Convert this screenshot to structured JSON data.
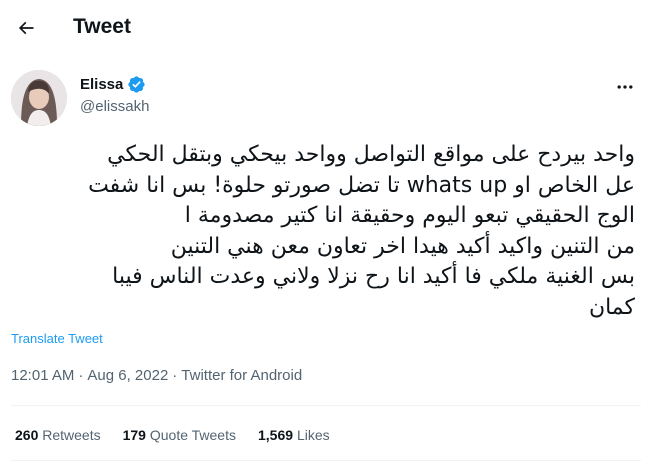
{
  "header": {
    "title": "Tweet",
    "back_icon": "arrow-left-icon"
  },
  "author": {
    "display_name": "Elissa",
    "handle": "@elissakh",
    "verified_color": "#1d9bf0"
  },
  "tweet": {
    "lines": [
      "واحد بيردح  على مواقع التواصل وواحد بيحكي  وبتقل الحكي",
      "عل الخاص او whats up تا تضل صورتو حلوة! بس انا شفت",
      "الوج الحقيقي تبعو اليوم وحقيقة انا كتير  مصدومة ا",
      "من التنين واكيد أكيد هيدا اخر تعاون معن هني التنين",
      "بس الغنية ملكي فا أكيد انا رح نزلا ولاني وعدت الناس فيبا",
      "كمان"
    ],
    "translate_label": "Translate Tweet"
  },
  "meta": {
    "time": "12:01 AM",
    "separator": "·",
    "date": "Aug 6, 2022",
    "source": "Twitter for Android"
  },
  "stats": {
    "retweets_count": "260",
    "retweets_label": "Retweets",
    "quotes_count": "179",
    "quotes_label": "Quote Tweets",
    "likes_count": "1,569",
    "likes_label": "Likes"
  },
  "colors": {
    "accent": "#1d9bf0",
    "secondary_text": "#536471",
    "divider": "#eff3f4"
  }
}
